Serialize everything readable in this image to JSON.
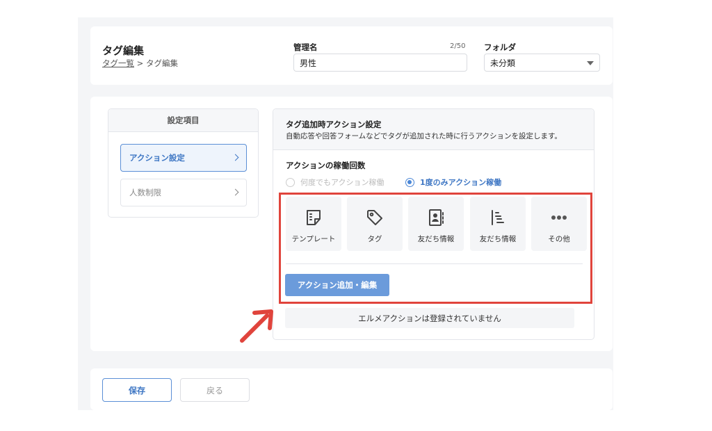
{
  "header": {
    "title": "タグ編集",
    "breadcrumb": {
      "parent": "タグ一覧",
      "separator": ">",
      "current": "タグ編集"
    },
    "name_field": {
      "label": "管理名",
      "counter": "2/50",
      "value": "男性"
    },
    "folder_field": {
      "label": "フォルダ",
      "value": "未分類"
    }
  },
  "sidebar": {
    "heading": "設定項目",
    "items": [
      {
        "label": "アクション設定",
        "active": true
      },
      {
        "label": "人数制限",
        "active": false
      }
    ]
  },
  "panel": {
    "title": "タグ追加時アクション設定",
    "description": "自動応答や回答フォームなどでタグが追加された時に行うアクションを設定します。",
    "run_count_label": "アクションの稼働回数",
    "options": [
      {
        "label": "何度でもアクション稼働",
        "selected": false
      },
      {
        "label": "1度のみアクション稼働",
        "selected": true
      }
    ],
    "tiles": [
      {
        "label": "テンプレート",
        "icon": "template-icon"
      },
      {
        "label": "タグ",
        "icon": "tag-icon"
      },
      {
        "label": "友だち情報",
        "icon": "contact-card-icon"
      },
      {
        "label": "友だち情報",
        "icon": "list-icon"
      },
      {
        "label": "その他",
        "icon": "more-icon"
      }
    ],
    "add_button": "アクション追加・編集",
    "empty_message": "エルメアクションは登録されていません"
  },
  "footer": {
    "save": "保存",
    "back": "戻る"
  },
  "colors": {
    "accent": "#4a86d6",
    "highlight": "#e0443c"
  }
}
